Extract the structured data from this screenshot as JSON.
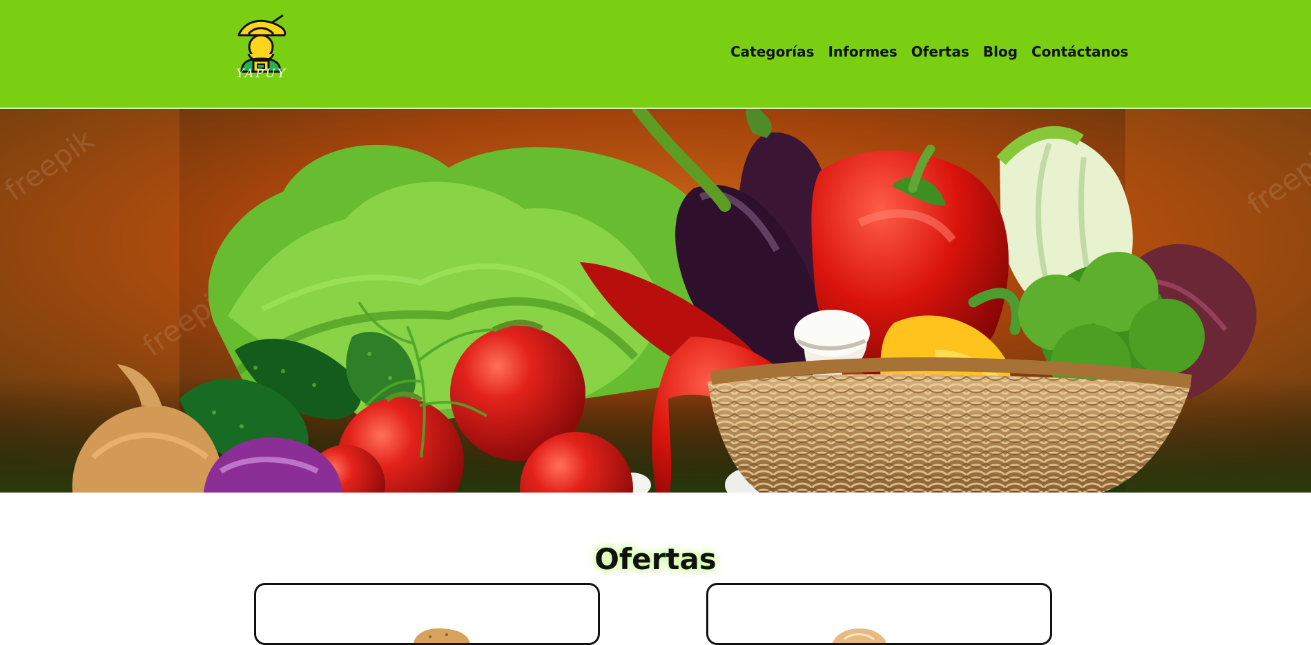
{
  "brand": {
    "name": "YAPUY",
    "logo_icon": "farmer-icon",
    "accent_color": "#7acf12"
  },
  "nav": {
    "items": [
      {
        "label": "Categorías"
      },
      {
        "label": "Informes"
      },
      {
        "label": "Ofertas"
      },
      {
        "label": "Blog"
      },
      {
        "label": "Contáctanos"
      }
    ]
  },
  "hero": {
    "image_subject": "fresh vegetables basket",
    "watermark": "freepik"
  },
  "offers": {
    "title": "Ofertas",
    "cards": [
      {
        "product_icon": "potato-icon"
      },
      {
        "product_icon": "onion-icon"
      }
    ]
  }
}
